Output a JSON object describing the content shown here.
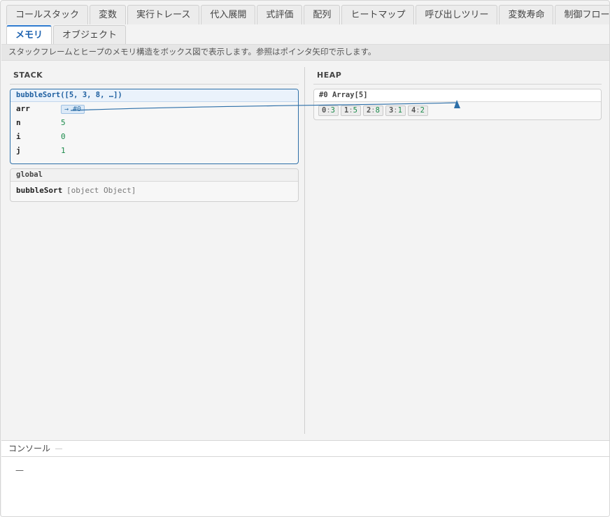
{
  "tabs": {
    "row1": [
      "コールスタック",
      "変数",
      "実行トレース",
      "代入展開",
      "式評価",
      "配列",
      "ヒートマップ",
      "呼び出しツリー",
      "変数寿命",
      "制御フロー"
    ],
    "row2": [
      "メモリ",
      "オブジェクト"
    ],
    "active": "メモリ"
  },
  "info": "スタックフレームとヒープのメモリ構造をボックス図で表示します。参照はポインタ矢印で示します。",
  "stack": {
    "title": "STACK",
    "frames": [
      {
        "header": "bubbleSort([5, 3, 8, …])",
        "vars": [
          {
            "name": "arr",
            "pointer": "→ #0"
          },
          {
            "name": "n",
            "value": "5"
          },
          {
            "name": "i",
            "value": "0"
          },
          {
            "name": "j",
            "value": "1"
          }
        ]
      },
      {
        "header": "global",
        "vars": [
          {
            "name": "bubbleSort",
            "value": "[object Object]"
          }
        ]
      }
    ]
  },
  "heap": {
    "title": "HEAP",
    "objects": [
      {
        "header": "#0 Array[5]",
        "cells": [
          {
            "i": "0",
            "v": "3"
          },
          {
            "i": "1",
            "v": "5"
          },
          {
            "i": "2",
            "v": "8"
          },
          {
            "i": "3",
            "v": "1"
          },
          {
            "i": "4",
            "v": "2"
          }
        ]
      }
    ]
  },
  "console": {
    "title": "コンソール",
    "line": "—"
  },
  "colors": {
    "accent": "#2f7bd0",
    "pointer_arrow": "#2d6fa8",
    "value_green": "#1a8a4a"
  }
}
